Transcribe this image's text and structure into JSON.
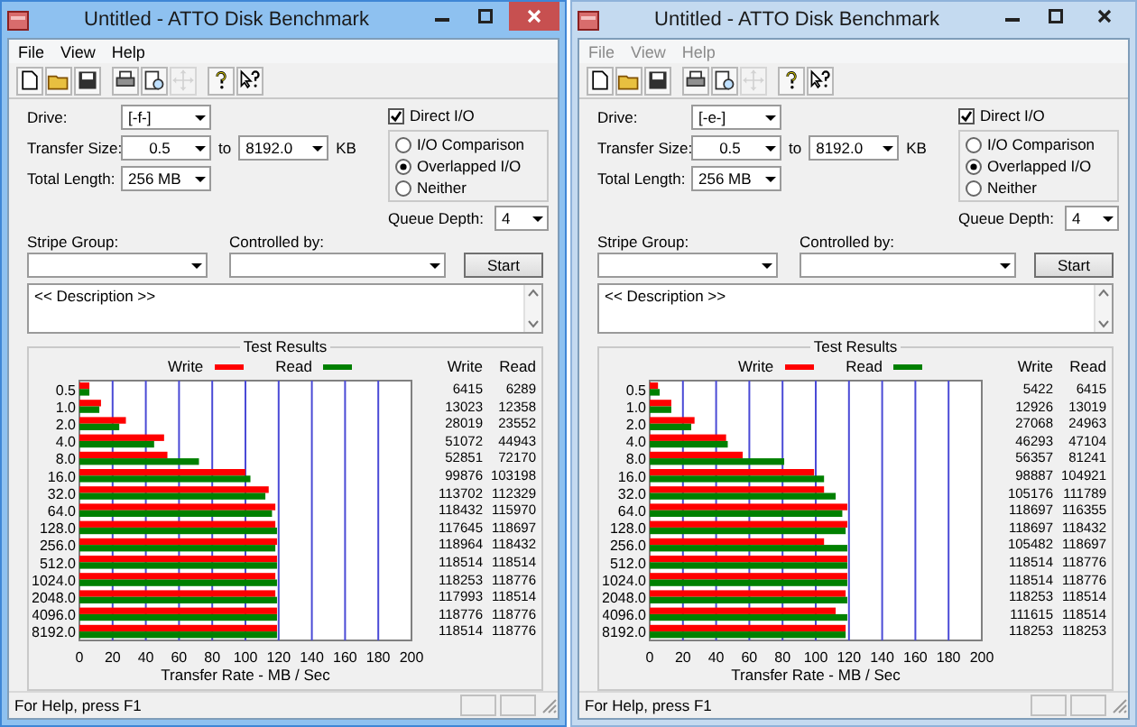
{
  "windows": [
    {
      "title": "Untitled - ATTO Disk Benchmark",
      "active": true,
      "menu": [
        "File",
        "View",
        "Help"
      ],
      "toolbar": [
        {
          "disabled": false
        },
        {
          "disabled": false
        },
        {
          "disabled": false
        },
        {
          "disabled": false
        },
        {
          "disabled": false
        },
        {
          "disabled": true
        },
        {
          "disabled": false
        },
        {
          "disabled": false
        }
      ],
      "form": {
        "drive_label": "Drive:",
        "drive": "[-f-]",
        "transfer_size_label": "Transfer Size:",
        "transfer_from": "0.5",
        "to_label": "to",
        "transfer_to": "8192.0",
        "unit": "KB",
        "total_length_label": "Total Length:",
        "total_length": "256 MB",
        "direct_io": {
          "label": "Direct I/O",
          "checked": true
        },
        "io_modes": [
          {
            "label": "I/O Comparison",
            "selected": false
          },
          {
            "label": "Overlapped I/O",
            "selected": true
          },
          {
            "label": "Neither",
            "selected": false
          }
        ],
        "queue_depth_label": "Queue Depth:",
        "queue_depth": "4",
        "stripe_group_label": "Stripe Group:",
        "controlled_by_label": "Controlled by:",
        "start_button": "Start",
        "description": "<< Description >>"
      },
      "results": {
        "title": "Test Results",
        "table_headers": [
          "Write",
          "Read"
        ],
        "rows": [
          {
            "write": "6415",
            "read": "6289"
          },
          {
            "write": "13023",
            "read": "12358"
          },
          {
            "write": "28019",
            "read": "23552"
          },
          {
            "write": "51072",
            "read": "44943"
          },
          {
            "write": "52851",
            "read": "72170"
          },
          {
            "write": "99876",
            "read": "103198"
          },
          {
            "write": "113702",
            "read": "112329"
          },
          {
            "write": "118432",
            "read": "115970"
          },
          {
            "write": "117645",
            "read": "118697"
          },
          {
            "write": "118964",
            "read": "118432"
          },
          {
            "write": "118514",
            "read": "118514"
          },
          {
            "write": "118253",
            "read": "118776"
          },
          {
            "write": "117993",
            "read": "118514"
          },
          {
            "write": "118776",
            "read": "118776"
          },
          {
            "write": "118514",
            "read": "118776"
          }
        ],
        "chart_data": {
          "type": "bar",
          "orientation": "horizontal",
          "grid": true,
          "xlabel": "Transfer Rate - MB / Sec",
          "categories": [
            "0.5",
            "1.0",
            "2.0",
            "4.0",
            "8.0",
            "16.0",
            "32.0",
            "64.0",
            "128.0",
            "256.0",
            "512.0",
            "1024.0",
            "2048.0",
            "4096.0",
            "8192.0"
          ],
          "xlim": [
            0,
            200
          ],
          "xticks": [
            0,
            20,
            40,
            60,
            80,
            100,
            120,
            140,
            160,
            180,
            200
          ],
          "series": [
            {
              "name": "Write",
              "color": "#ff0000",
              "values": [
                6,
                13,
                28,
                51,
                53,
                100,
                114,
                118,
                118,
                119,
                119,
                118,
                118,
                119,
                119
              ]
            },
            {
              "name": "Read",
              "color": "#008000",
              "values": [
                6,
                12,
                24,
                45,
                72,
                103,
                112,
                116,
                119,
                118,
                119,
                119,
                119,
                119,
                119
              ]
            }
          ],
          "legend": "top"
        }
      },
      "status": "For Help, press F1"
    },
    {
      "title": "Untitled - ATTO Disk Benchmark",
      "active": false,
      "menu": [
        "File",
        "View",
        "Help"
      ],
      "toolbar": [
        {
          "disabled": false
        },
        {
          "disabled": false
        },
        {
          "disabled": false
        },
        {
          "disabled": false
        },
        {
          "disabled": false
        },
        {
          "disabled": true
        },
        {
          "disabled": false
        },
        {
          "disabled": false
        }
      ],
      "form": {
        "drive_label": "Drive:",
        "drive": "[-e-]",
        "transfer_size_label": "Transfer Size:",
        "transfer_from": "0.5",
        "to_label": "to",
        "transfer_to": "8192.0",
        "unit": "KB",
        "total_length_label": "Total Length:",
        "total_length": "256 MB",
        "direct_io": {
          "label": "Direct I/O",
          "checked": true
        },
        "io_modes": [
          {
            "label": "I/O Comparison",
            "selected": false
          },
          {
            "label": "Overlapped I/O",
            "selected": true
          },
          {
            "label": "Neither",
            "selected": false
          }
        ],
        "queue_depth_label": "Queue Depth:",
        "queue_depth": "4",
        "stripe_group_label": "Stripe Group:",
        "controlled_by_label": "Controlled by:",
        "start_button": "Start",
        "description": "<< Description >>"
      },
      "results": {
        "title": "Test Results",
        "table_headers": [
          "Write",
          "Read"
        ],
        "rows": [
          {
            "write": "5422",
            "read": "6415"
          },
          {
            "write": "12926",
            "read": "13019"
          },
          {
            "write": "27068",
            "read": "24963"
          },
          {
            "write": "46293",
            "read": "47104"
          },
          {
            "write": "56357",
            "read": "81241"
          },
          {
            "write": "98887",
            "read": "104921"
          },
          {
            "write": "105176",
            "read": "111789"
          },
          {
            "write": "118697",
            "read": "116355"
          },
          {
            "write": "118697",
            "read": "118432"
          },
          {
            "write": "105482",
            "read": "118697"
          },
          {
            "write": "118514",
            "read": "118776"
          },
          {
            "write": "118514",
            "read": "118776"
          },
          {
            "write": "118253",
            "read": "118514"
          },
          {
            "write": "111615",
            "read": "118514"
          },
          {
            "write": "118253",
            "read": "118253"
          }
        ],
        "chart_data": {
          "type": "bar",
          "orientation": "horizontal",
          "grid": true,
          "xlabel": "Transfer Rate - MB / Sec",
          "categories": [
            "0.5",
            "1.0",
            "2.0",
            "4.0",
            "8.0",
            "16.0",
            "32.0",
            "64.0",
            "128.0",
            "256.0",
            "512.0",
            "1024.0",
            "2048.0",
            "4096.0",
            "8192.0"
          ],
          "xlim": [
            0,
            200
          ],
          "xticks": [
            0,
            20,
            40,
            60,
            80,
            100,
            120,
            140,
            160,
            180,
            200
          ],
          "series": [
            {
              "name": "Write",
              "color": "#ff0000",
              "values": [
                5,
                13,
                27,
                46,
                56,
                99,
                105,
                119,
                119,
                105,
                119,
                119,
                118,
                112,
                118
              ]
            },
            {
              "name": "Read",
              "color": "#008000",
              "values": [
                6,
                13,
                25,
                47,
                81,
                105,
                112,
                116,
                118,
                119,
                119,
                119,
                119,
                119,
                118
              ]
            }
          ],
          "legend": "top"
        }
      },
      "status": "For Help, press F1"
    }
  ]
}
